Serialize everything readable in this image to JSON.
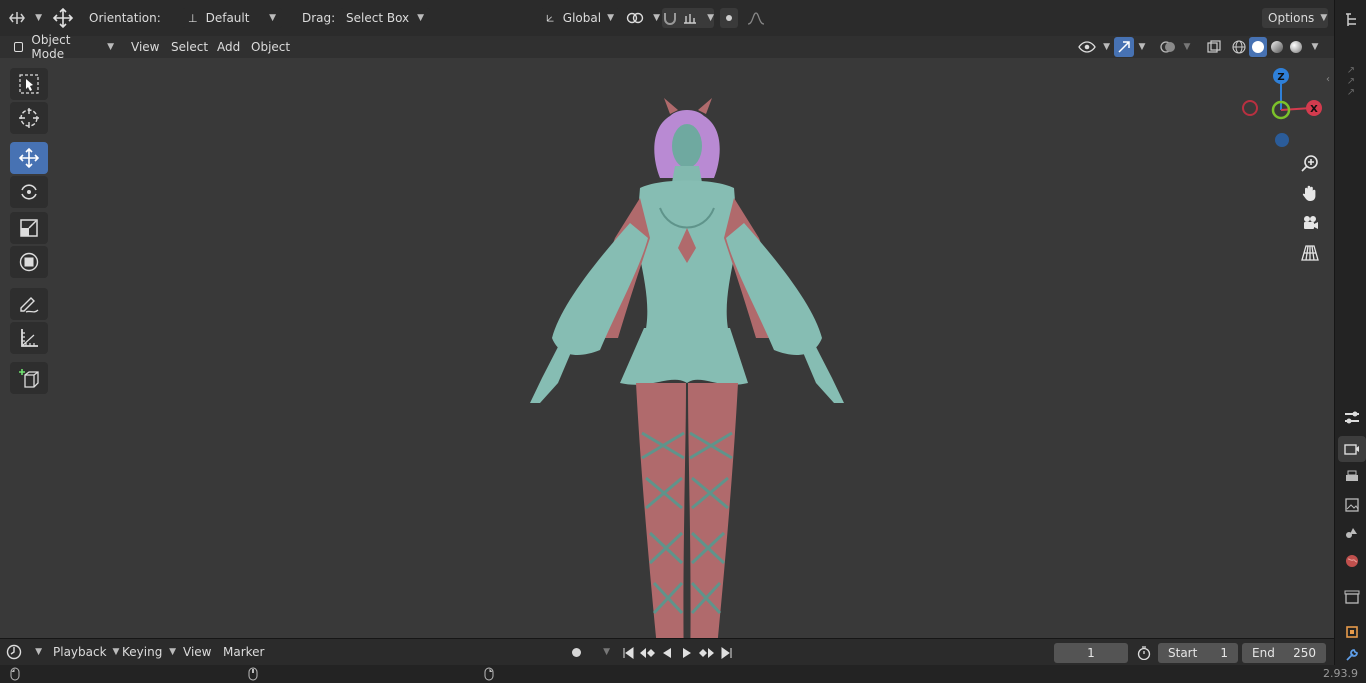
{
  "tool_header": {
    "orientation_label": "Orientation:",
    "orientation_value": "Default",
    "drag_label": "Drag:",
    "drag_value": "Select Box",
    "transform_space": "Global",
    "options_label": "Options"
  },
  "view_header": {
    "mode": "Object Mode",
    "menus": [
      "View",
      "Select",
      "Add",
      "Object"
    ]
  },
  "gizmo": {
    "z_label": "Z",
    "x_label": "X"
  },
  "timeline": {
    "menus": [
      "Playback",
      "Keying",
      "View",
      "Marker"
    ],
    "current_frame": "1",
    "start_label": "Start",
    "start_value": "1",
    "end_label": "End",
    "end_value": "250"
  },
  "status": {
    "version": "2.93.9"
  },
  "colors": {
    "accent": "#4772b3",
    "model_cloth": "#86bdb3",
    "model_skin": "#b06a6c",
    "model_hair": "#b98ad3",
    "viewport_bg": "#393939"
  }
}
